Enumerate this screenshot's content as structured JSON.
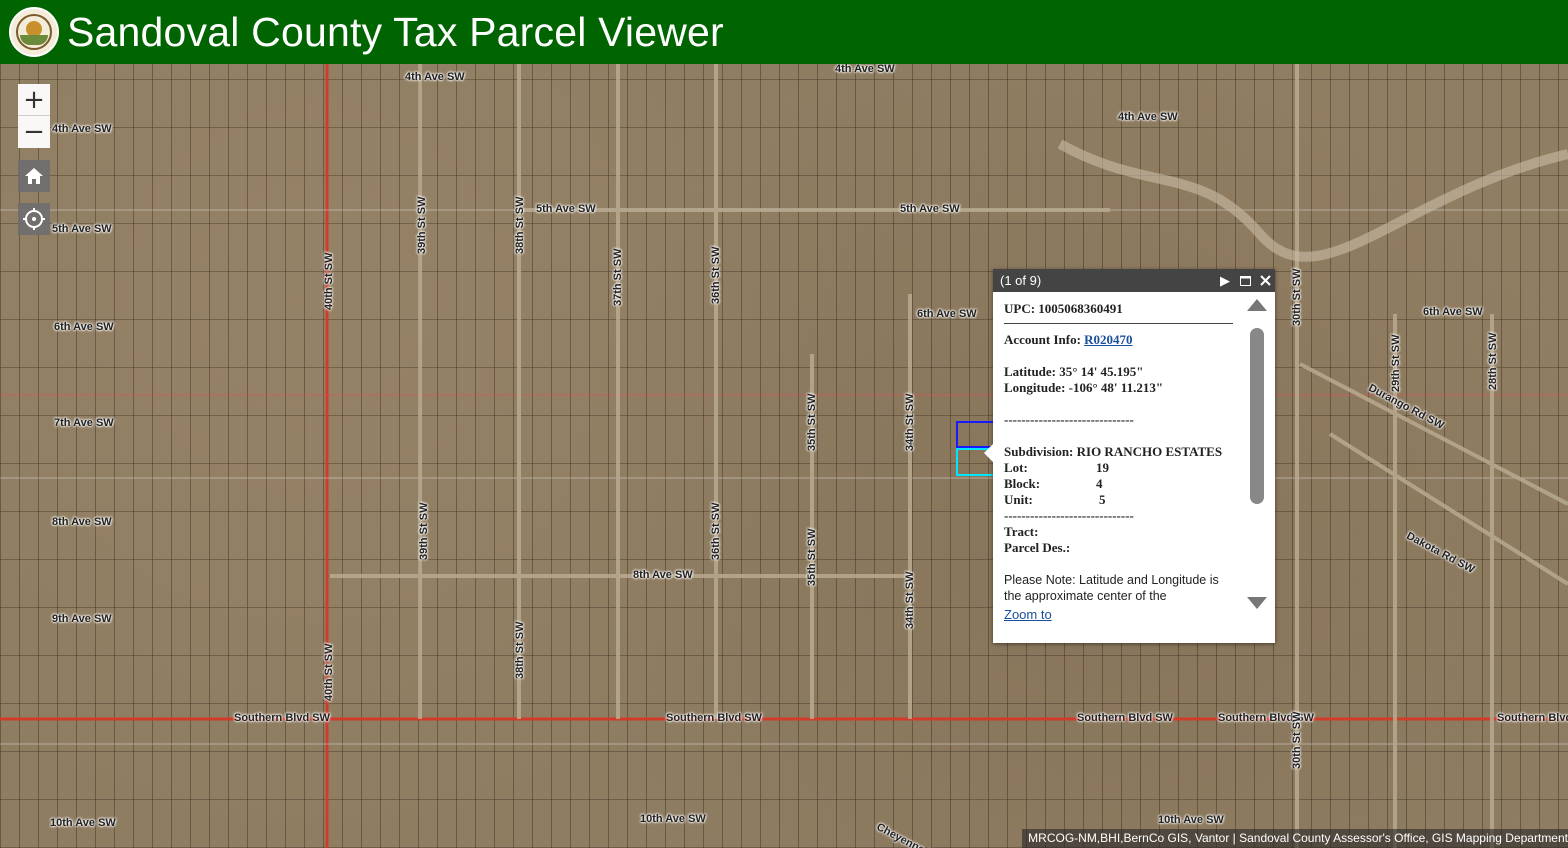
{
  "header": {
    "title": "Sandoval County Tax Parcel Viewer",
    "logo_icon": "county-seal-icon"
  },
  "map": {
    "controls": {
      "zoom_in": "+",
      "zoom_out": "−",
      "home_icon": "home-icon",
      "locate_icon": "locate-crosshair-icon"
    },
    "road_labels": [
      "4th Ave SW",
      "4th Ave SW",
      "4th Ave SW",
      "4th Ave SW",
      "5th Ave SW",
      "5th Ave SW",
      "5th Ave SW",
      "6th Ave SW",
      "6th Ave SW",
      "6th Ave SW",
      "7th Ave SW",
      "8th Ave SW",
      "8th Ave SW",
      "9th Ave SW",
      "10th Ave SW",
      "10th Ave SW",
      "10th Ave SW",
      "Southern Blvd SW",
      "Southern Blvd SW",
      "Southern Blvd SW",
      "Southern Blvd SW",
      "Southern Blvd SW",
      "40th St SW",
      "40th St SW",
      "39th St SW",
      "39th St SW",
      "38th St SW",
      "38th St SW",
      "37th St SW",
      "36th St SW",
      "36th St SW",
      "35th St SW",
      "35th St SW",
      "34th St SW",
      "34th St SW",
      "30th St SW",
      "30th St SW",
      "29th St SW",
      "28th St SW",
      "Durango Rd SW",
      "Dakota Rd SW",
      "Cheyenne Rd"
    ],
    "attribution": "MRCOG-NM,BHI,BernCo GIS, Vantor | Sandoval County Assessor's Office, GIS Mapping Department"
  },
  "popup": {
    "count": "(1 of 9)",
    "upc": "UPC: 1005068360491",
    "account_label": "Account Info: ",
    "account_value": "R020470",
    "latitude": "Latitude: 35° 14' 45.195\"",
    "longitude": "Longitude: -106° 48' 11.213\"",
    "separator": "------------------------------",
    "subdivision_label": "Subdivision: ",
    "subdivision_value": "RIO RANCHO ESTATES",
    "lot_label": "Lot:",
    "lot_value": "19",
    "block_label": "Block:",
    "block_value": "4",
    "unit_label": "Unit:",
    "unit_value": "5",
    "tract_label": "Tract:",
    "parcel_des_label": "Parcel Des.:",
    "note": "Please Note: Latitude and Longitude is the approximate center of the",
    "zoom_link": "Zoom to"
  }
}
